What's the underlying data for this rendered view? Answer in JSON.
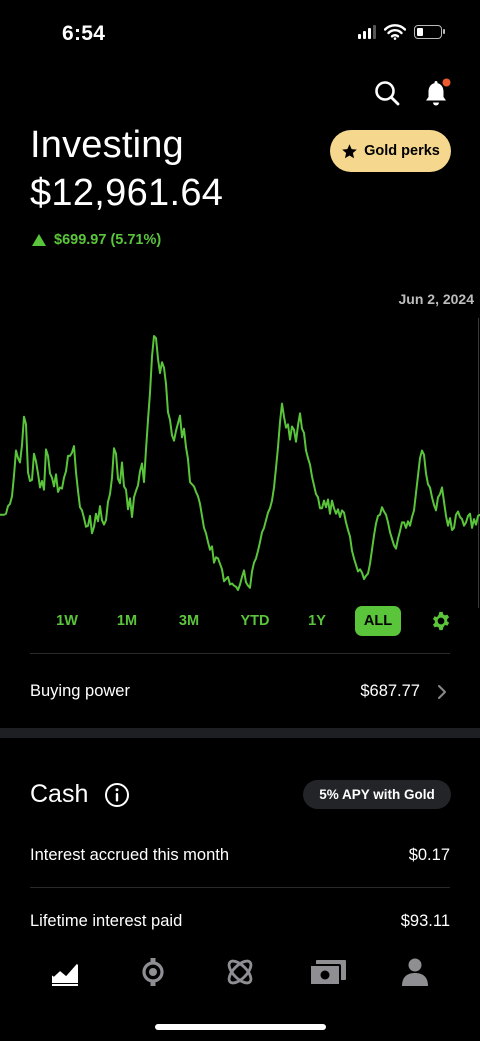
{
  "status_bar": {
    "time": "6:54"
  },
  "header": {
    "title": "Investing",
    "portfolio_value": "$12,961.64",
    "change": "$699.97 (5.71%)",
    "gold_button": "Gold perks"
  },
  "chart": {
    "date_label": "Jun 2, 2024",
    "line_color": "#5ac53b",
    "ranges": [
      "1W",
      "1M",
      "3M",
      "YTD",
      "1Y",
      "ALL"
    ],
    "active_range": "ALL"
  },
  "chart_data": {
    "type": "line",
    "title": "",
    "xlabel": "",
    "ylabel": "",
    "series": [
      {
        "values": [
          73,
          73,
          73,
          74,
          81,
          83,
          90,
          109,
          132,
          125,
          121,
          137,
          163,
          156,
          112,
          104,
          105,
          129,
          122,
          111,
          98,
          104,
          96,
          133,
          127,
          111,
          107,
          99,
          110,
          94,
          98,
          97,
          107,
          113,
          127,
          127,
          130,
          136,
          112,
          95,
          80,
          77,
          70,
          62,
          63,
          72,
          56,
          62,
          74,
          67,
          81,
          68,
          64,
          68,
          85,
          92,
          107,
          134,
          129,
          106,
          102,
          121,
          99,
          96,
          78,
          88,
          71,
          89,
          95,
          100,
          113,
          120,
          103,
          133,
          160,
          185,
          218,
          237,
          235,
          216,
          203,
          213,
          208,
          193,
          167,
          160,
          146,
          141,
          150,
          157,
          164,
          144,
          152,
          135,
          124,
          103,
          101,
          99,
          94,
          90,
          83,
          72,
          61,
          56,
          48,
          41,
          44,
          29,
          34,
          33,
          28,
          23,
          12,
          14,
          16,
          9,
          10,
          8,
          7,
          4,
          9,
          16,
          22,
          11,
          8,
          6,
          21,
          29,
          33,
          40,
          48,
          57,
          61,
          68,
          75,
          79,
          86,
          98,
          116,
          135,
          158,
          175,
          163,
          153,
          156,
          142,
          154,
          151,
          140,
          155,
          166,
          152,
          148,
          132,
          125,
          119,
          108,
          100,
          92,
          89,
          79,
          79,
          86,
          80,
          87,
          74,
          86,
          79,
          74,
          78,
          71,
          77,
          75,
          66,
          59,
          53,
          40,
          33,
          27,
          21,
          23,
          20,
          14,
          17,
          19,
          28,
          41,
          54,
          65,
          72,
          73,
          80,
          76,
          73,
          66,
          57,
          51,
          45,
          42,
          51,
          58,
          66,
          66,
          61,
          67,
          63,
          71,
          77,
          93,
          109,
          125,
          132,
          128,
          111,
          101,
          98,
          89,
          82,
          77,
          89,
          92,
          98,
          85,
          72,
          63,
          70,
          59,
          61,
          73,
          76,
          71,
          69,
          63,
          66,
          72,
          74,
          61,
          69,
          64,
          72,
          73
        ]
      }
    ],
    "grid": false
  },
  "buying_power": {
    "label": "Buying power",
    "value": "$687.77"
  },
  "cash": {
    "title": "Cash",
    "apy_badge": "5% APY with Gold",
    "rows": [
      {
        "label": "Interest accrued this month",
        "value": "$0.17"
      },
      {
        "label": "Lifetime interest paid",
        "value": "$93.11"
      }
    ]
  },
  "tabbar": {
    "icons": [
      "chart-icon",
      "crypto-icon",
      "browse-icon",
      "cash-card-icon",
      "account-icon"
    ]
  }
}
